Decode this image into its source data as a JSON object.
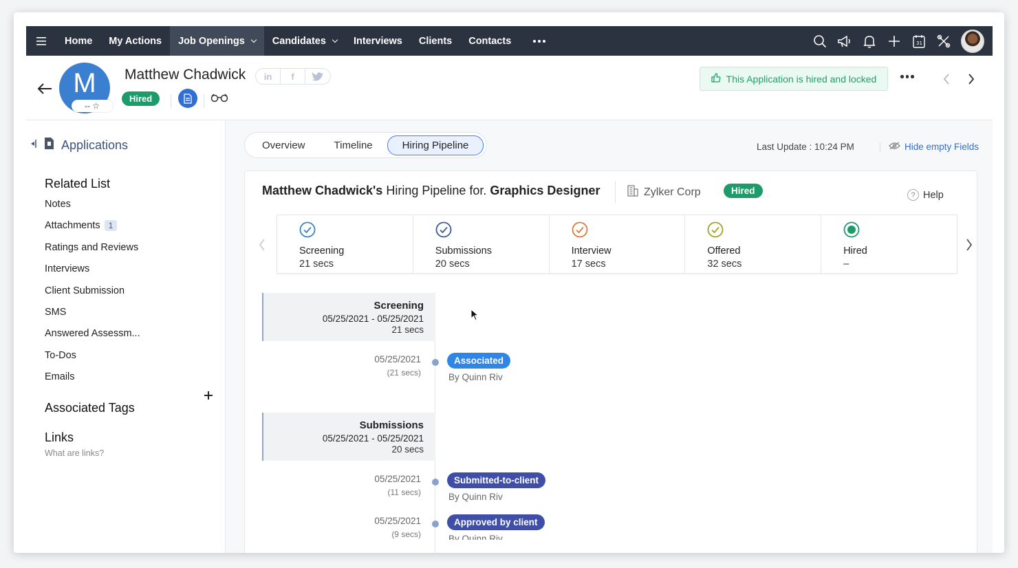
{
  "nav": {
    "items": [
      {
        "label": "Home",
        "active": false,
        "caret": false
      },
      {
        "label": "My Actions",
        "active": false,
        "caret": false
      },
      {
        "label": "Job Openings",
        "active": true,
        "caret": true
      },
      {
        "label": "Candidates",
        "active": false,
        "caret": true
      },
      {
        "label": "Interviews",
        "active": false,
        "caret": false
      },
      {
        "label": "Clients",
        "active": false,
        "caret": false
      },
      {
        "label": "Contacts",
        "active": false,
        "caret": false
      }
    ],
    "right_icons": [
      "search-icon",
      "megaphone-icon",
      "bell-icon",
      "plus-icon",
      "calendar-icon",
      "tools-icon"
    ]
  },
  "header": {
    "avatar_letter": "M",
    "rating_text": "-- ☆",
    "name": "Matthew Chadwick",
    "social": [
      "in",
      "f",
      "t"
    ],
    "status": "Hired",
    "locked_message": "This Application is hired and locked"
  },
  "sidebar": {
    "applications_label": "Applications",
    "related_list_title": "Related List",
    "items": [
      {
        "label": "Notes",
        "count": ""
      },
      {
        "label": "Attachments",
        "count": "1"
      },
      {
        "label": "Ratings and Reviews",
        "count": ""
      },
      {
        "label": "Interviews",
        "count": ""
      },
      {
        "label": "Client Submission",
        "count": ""
      },
      {
        "label": "SMS",
        "count": ""
      },
      {
        "label": "Answered Assessm...",
        "count": ""
      },
      {
        "label": "To-Dos",
        "count": ""
      },
      {
        "label": "Emails",
        "count": ""
      }
    ],
    "associated_tags_title": "Associated Tags",
    "links_title": "Links",
    "links_sub": "What are links?"
  },
  "main": {
    "tabs": [
      "Overview",
      "Timeline",
      "Hiring Pipeline"
    ],
    "active_tab": "Hiring Pipeline",
    "last_update": "Last Update : 10:24 PM",
    "hide_empty": "Hide empty Fields"
  },
  "pipeline": {
    "candidate": "Matthew Chadwick's",
    "middle_text": " Hiring Pipeline for. ",
    "job": "Graphics Designer",
    "company": "Zylker Corp",
    "status": "Hired",
    "help": "Help",
    "stages": [
      {
        "name": "Screening",
        "duration": "21 secs",
        "color": "#3b82c4",
        "type": "check"
      },
      {
        "name": "Submissions",
        "duration": "20 secs",
        "color": "#3d5a99",
        "type": "check"
      },
      {
        "name": "Interview",
        "duration": "17 secs",
        "color": "#e0793a",
        "type": "check"
      },
      {
        "name": "Offered",
        "duration": "32 secs",
        "color": "#a3a12a",
        "type": "check"
      },
      {
        "name": "Hired",
        "duration": "–",
        "color": "#1e9b6a",
        "type": "filled"
      }
    ]
  },
  "timeline": {
    "groups": [
      {
        "title": "Screening",
        "range": "05/25/2021 - 05/25/2021",
        "duration": "21 secs"
      },
      {
        "title": "Submissions",
        "range": "05/25/2021 - 05/25/2021",
        "duration": "20 secs"
      }
    ],
    "events": [
      {
        "date": "05/25/2021",
        "duration": "(21 secs)",
        "status": "Associated",
        "by": "By Quinn Riv",
        "color": "#2f86e6"
      },
      {
        "date": "05/25/2021",
        "duration": "(11 secs)",
        "status": "Submitted-to-client",
        "by": "By Quinn Riv",
        "color": "#3f4fa8"
      },
      {
        "date": "05/25/2021",
        "duration": "(9 secs)",
        "status": "Approved by client",
        "by": "By Quinn Riv",
        "color": "#3f4fa8"
      }
    ]
  }
}
